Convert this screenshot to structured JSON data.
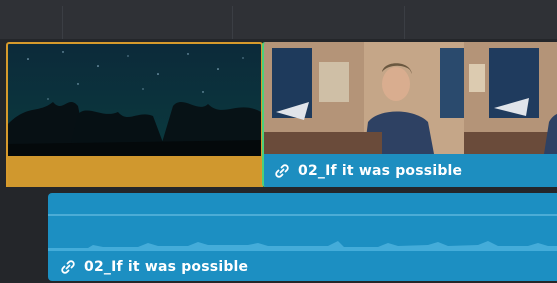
{
  "timeline": {
    "video_track": {
      "clips": [
        {
          "name": "",
          "selected": true,
          "color": "#d79a2c"
        },
        {
          "name": "02_If it was possible",
          "linked": true,
          "color": "#1d8ec0"
        }
      ]
    },
    "audio_track": {
      "clips": [
        {
          "name": "02_If it was possible",
          "linked": true,
          "color": "#1c8fc2"
        }
      ]
    }
  },
  "icons": {
    "link": "link-icon"
  },
  "colors": {
    "selection": "#d79a2c",
    "clip_blue": "#1d8ec0",
    "link_green": "#4cd07a"
  }
}
